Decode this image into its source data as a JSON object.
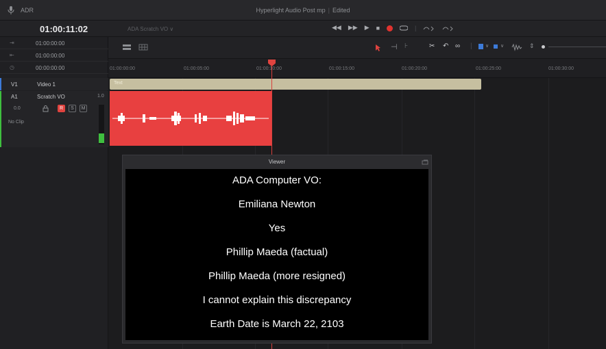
{
  "titlebar": {
    "panel": "ADR",
    "project": "Hyperlight Audio Post mp",
    "status": "Edited"
  },
  "toolbar": {
    "timecode": "01:00:11:02",
    "track_select": "ADA Scratch VO ∨"
  },
  "left_panel": {
    "rows": [
      {
        "icon": "⇥",
        "value": "01:00:00:00"
      },
      {
        "icon": "⇤",
        "value": "01:00:00:00"
      },
      {
        "icon": "◷",
        "value": "00:00:00:00"
      }
    ]
  },
  "tracks": {
    "video": {
      "id": "V1",
      "name": "Video 1"
    },
    "audio": {
      "id": "A1",
      "name": "Scratch VO",
      "level": "1.0",
      "volume": "0.0",
      "clip": "No Clip"
    },
    "buttons": {
      "record": "R",
      "solo": "S",
      "mute": "M"
    }
  },
  "ruler": {
    "ticks": [
      "01:00:00:00",
      "01:00:05:00",
      "01:00:10:00",
      "01:00:15:00",
      "01:00:20:00",
      "01:00:25:00",
      "01:00:30:00"
    ]
  },
  "clips": {
    "text_clip": "Text"
  },
  "viewer": {
    "title": "Viewer",
    "lines": [
      "ADA Computer VO:",
      "Emiliana Newton",
      "Yes",
      "Phillip Maeda (factual)",
      "Phillip Maeda (more resigned)",
      "I cannot explain this discrepancy",
      "Earth Date is March 22, 2103"
    ]
  },
  "colors": {
    "accent_red": "#e84040",
    "record": "#e0332f",
    "text_clip": "#c6bfa0",
    "blue": "#3d7bd9",
    "meter_green": "#3fbf3f"
  }
}
